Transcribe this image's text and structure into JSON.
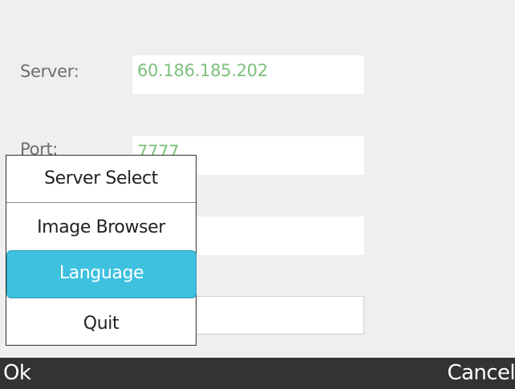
{
  "form": {
    "server_label": "Server:",
    "server_value": "60.186.185.202",
    "port_label": "Port:",
    "port_value": "7777",
    "password_value": "***"
  },
  "menu": {
    "items": [
      {
        "label": "Server Select",
        "selected": false
      },
      {
        "label": "Image Browser",
        "selected": false
      },
      {
        "label": "Language",
        "selected": true
      },
      {
        "label": "Quit",
        "selected": false
      }
    ]
  },
  "softkeys": {
    "left": "Ok",
    "right": "Cancel"
  },
  "colors": {
    "background": "#efefef",
    "field_text": "#7dc07d",
    "selection": "#3ec1de",
    "softkey_bar": "#333333"
  }
}
